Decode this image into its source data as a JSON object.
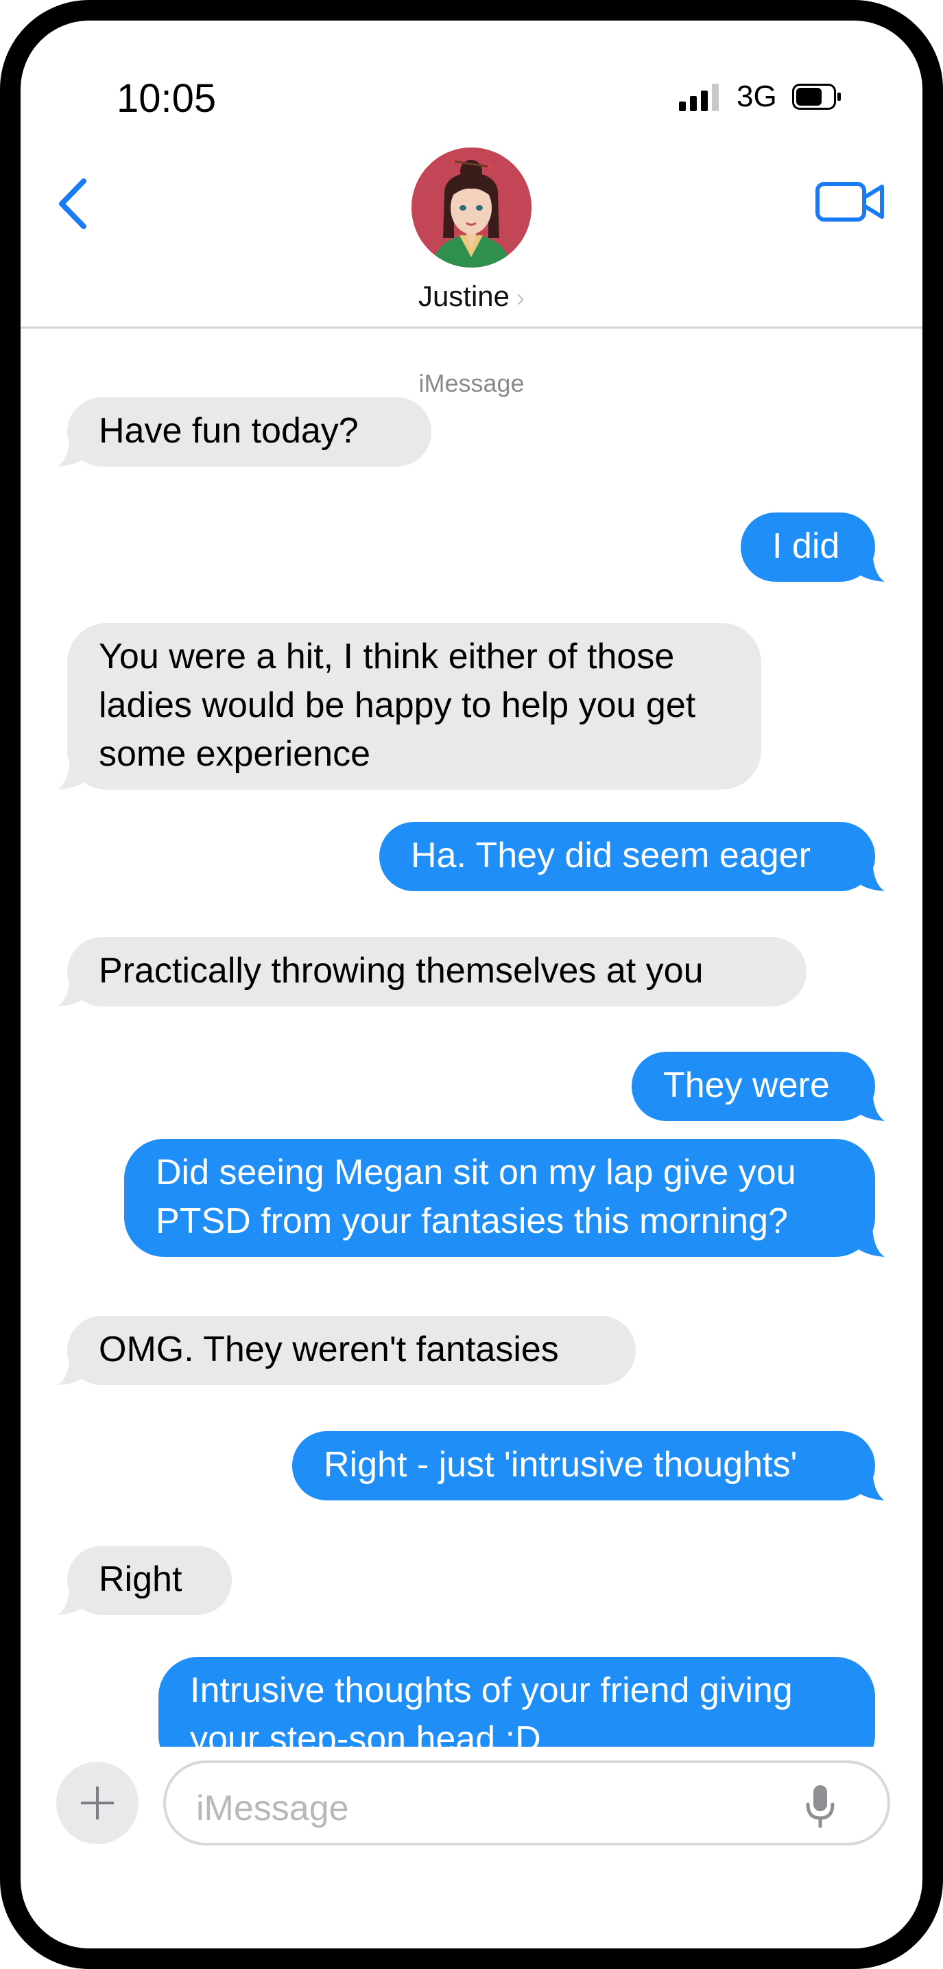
{
  "status_bar": {
    "time": "10:05",
    "network": "3G",
    "battery_level": 0.72,
    "signal_bars": 3
  },
  "header": {
    "contact_name": "Justine",
    "contact_chevron": "›",
    "back_icon": "chevron-left-icon",
    "video_icon": "video-camera-icon"
  },
  "conversation": {
    "service_label": "iMessage",
    "messages": [
      {
        "side": "in",
        "lines": [
          "Have fun today?"
        ]
      },
      {
        "side": "out",
        "lines": [
          "I did"
        ]
      },
      {
        "side": "in",
        "lines": [
          "You were a hit, I think either of those",
          "ladies would be happy to help you get",
          "some experience"
        ]
      },
      {
        "side": "out",
        "lines": [
          "Ha.  They did seem eager"
        ]
      },
      {
        "side": "in",
        "lines": [
          "Practically throwing themselves at you"
        ]
      },
      {
        "side": "out",
        "lines": [
          "They were"
        ]
      },
      {
        "side": "out",
        "lines": [
          "Did seeing Megan sit on my lap give you",
          "PTSD from your fantasies this morning?"
        ]
      },
      {
        "side": "in",
        "lines": [
          "OMG.  They weren't fantasies"
        ]
      },
      {
        "side": "out",
        "lines": [
          "Right - just 'intrusive thoughts'"
        ]
      },
      {
        "side": "in",
        "lines": [
          "Right"
        ]
      },
      {
        "side": "out",
        "lines": [
          "Intrusive thoughts of your friend giving",
          "your step-son head :D"
        ]
      }
    ]
  },
  "composer": {
    "placeholder": "iMessage",
    "plus_icon": "plus-icon",
    "mic_icon": "microphone-icon"
  },
  "colors": {
    "incoming": "#e9e9eb",
    "outgoing": "#1f8ef7",
    "accent": "#1a7cf5"
  }
}
